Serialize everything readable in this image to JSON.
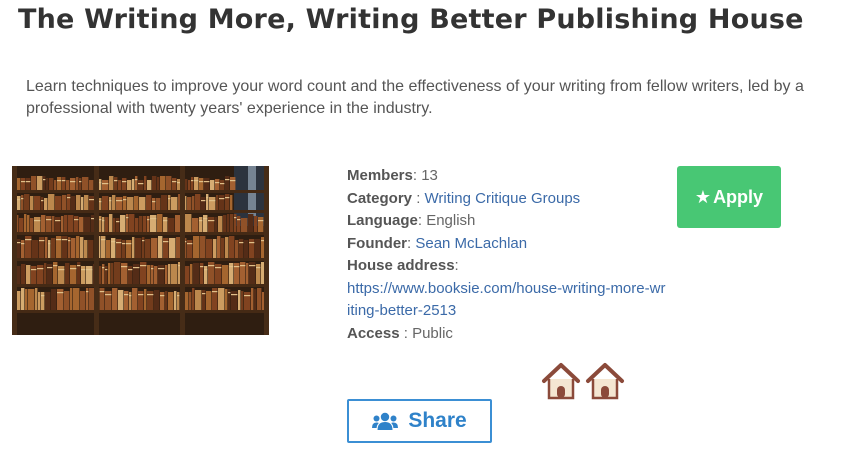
{
  "house": {
    "title": "The Writing More, Writing Better Publishing House",
    "description": "Learn techniques to improve your word count and the effectiveness of your writing from fellow writers, led by a professional with twenty years' experience in the industry."
  },
  "details": {
    "members_label": "Members",
    "members_value": "13",
    "category_label": "Category",
    "category_value": "Writing Critique Groups",
    "language_label": "Language",
    "language_value": "English",
    "founder_label": "Founder",
    "founder_value": "Sean McLachlan",
    "address_label": "House address",
    "address_value": "https://www.booksie.com/house-writing-more-writing-better-2513",
    "access_label": "Access",
    "access_value": "Public"
  },
  "actions": {
    "apply_label": "Apply",
    "share_label": "Share"
  },
  "colors": {
    "apply_bg": "#48c774",
    "share_border": "#3b8fd4",
    "link": "#3b6aa8",
    "house_icon": "#8b4a3a"
  },
  "icons": [
    "star-icon",
    "house-icon",
    "users-icon"
  ]
}
